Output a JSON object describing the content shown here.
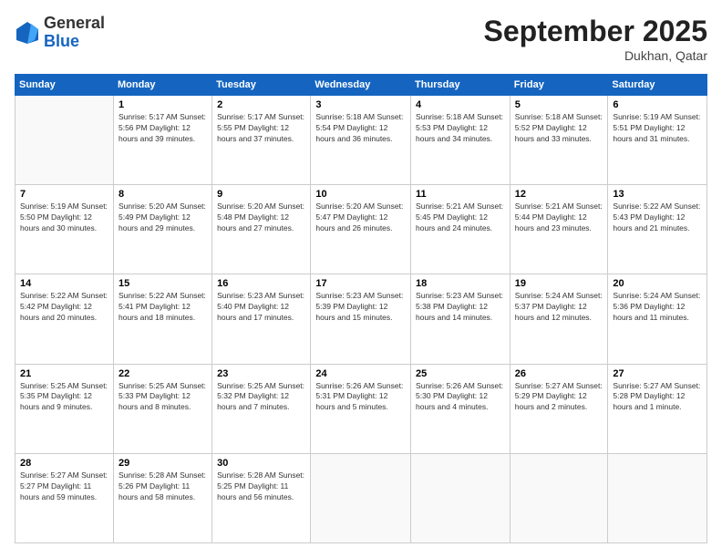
{
  "header": {
    "logo_general": "General",
    "logo_blue": "Blue",
    "month_title": "September 2025",
    "location": "Dukhan, Qatar"
  },
  "days_of_week": [
    "Sunday",
    "Monday",
    "Tuesday",
    "Wednesday",
    "Thursday",
    "Friday",
    "Saturday"
  ],
  "weeks": [
    [
      {
        "day": "",
        "info": ""
      },
      {
        "day": "1",
        "info": "Sunrise: 5:17 AM\nSunset: 5:56 PM\nDaylight: 12 hours\nand 39 minutes."
      },
      {
        "day": "2",
        "info": "Sunrise: 5:17 AM\nSunset: 5:55 PM\nDaylight: 12 hours\nand 37 minutes."
      },
      {
        "day": "3",
        "info": "Sunrise: 5:18 AM\nSunset: 5:54 PM\nDaylight: 12 hours\nand 36 minutes."
      },
      {
        "day": "4",
        "info": "Sunrise: 5:18 AM\nSunset: 5:53 PM\nDaylight: 12 hours\nand 34 minutes."
      },
      {
        "day": "5",
        "info": "Sunrise: 5:18 AM\nSunset: 5:52 PM\nDaylight: 12 hours\nand 33 minutes."
      },
      {
        "day": "6",
        "info": "Sunrise: 5:19 AM\nSunset: 5:51 PM\nDaylight: 12 hours\nand 31 minutes."
      }
    ],
    [
      {
        "day": "7",
        "info": "Sunrise: 5:19 AM\nSunset: 5:50 PM\nDaylight: 12 hours\nand 30 minutes."
      },
      {
        "day": "8",
        "info": "Sunrise: 5:20 AM\nSunset: 5:49 PM\nDaylight: 12 hours\nand 29 minutes."
      },
      {
        "day": "9",
        "info": "Sunrise: 5:20 AM\nSunset: 5:48 PM\nDaylight: 12 hours\nand 27 minutes."
      },
      {
        "day": "10",
        "info": "Sunrise: 5:20 AM\nSunset: 5:47 PM\nDaylight: 12 hours\nand 26 minutes."
      },
      {
        "day": "11",
        "info": "Sunrise: 5:21 AM\nSunset: 5:45 PM\nDaylight: 12 hours\nand 24 minutes."
      },
      {
        "day": "12",
        "info": "Sunrise: 5:21 AM\nSunset: 5:44 PM\nDaylight: 12 hours\nand 23 minutes."
      },
      {
        "day": "13",
        "info": "Sunrise: 5:22 AM\nSunset: 5:43 PM\nDaylight: 12 hours\nand 21 minutes."
      }
    ],
    [
      {
        "day": "14",
        "info": "Sunrise: 5:22 AM\nSunset: 5:42 PM\nDaylight: 12 hours\nand 20 minutes."
      },
      {
        "day": "15",
        "info": "Sunrise: 5:22 AM\nSunset: 5:41 PM\nDaylight: 12 hours\nand 18 minutes."
      },
      {
        "day": "16",
        "info": "Sunrise: 5:23 AM\nSunset: 5:40 PM\nDaylight: 12 hours\nand 17 minutes."
      },
      {
        "day": "17",
        "info": "Sunrise: 5:23 AM\nSunset: 5:39 PM\nDaylight: 12 hours\nand 15 minutes."
      },
      {
        "day": "18",
        "info": "Sunrise: 5:23 AM\nSunset: 5:38 PM\nDaylight: 12 hours\nand 14 minutes."
      },
      {
        "day": "19",
        "info": "Sunrise: 5:24 AM\nSunset: 5:37 PM\nDaylight: 12 hours\nand 12 minutes."
      },
      {
        "day": "20",
        "info": "Sunrise: 5:24 AM\nSunset: 5:36 PM\nDaylight: 12 hours\nand 11 minutes."
      }
    ],
    [
      {
        "day": "21",
        "info": "Sunrise: 5:25 AM\nSunset: 5:35 PM\nDaylight: 12 hours\nand 9 minutes."
      },
      {
        "day": "22",
        "info": "Sunrise: 5:25 AM\nSunset: 5:33 PM\nDaylight: 12 hours\nand 8 minutes."
      },
      {
        "day": "23",
        "info": "Sunrise: 5:25 AM\nSunset: 5:32 PM\nDaylight: 12 hours\nand 7 minutes."
      },
      {
        "day": "24",
        "info": "Sunrise: 5:26 AM\nSunset: 5:31 PM\nDaylight: 12 hours\nand 5 minutes."
      },
      {
        "day": "25",
        "info": "Sunrise: 5:26 AM\nSunset: 5:30 PM\nDaylight: 12 hours\nand 4 minutes."
      },
      {
        "day": "26",
        "info": "Sunrise: 5:27 AM\nSunset: 5:29 PM\nDaylight: 12 hours\nand 2 minutes."
      },
      {
        "day": "27",
        "info": "Sunrise: 5:27 AM\nSunset: 5:28 PM\nDaylight: 12 hours\nand 1 minute."
      }
    ],
    [
      {
        "day": "28",
        "info": "Sunrise: 5:27 AM\nSunset: 5:27 PM\nDaylight: 11 hours\nand 59 minutes."
      },
      {
        "day": "29",
        "info": "Sunrise: 5:28 AM\nSunset: 5:26 PM\nDaylight: 11 hours\nand 58 minutes."
      },
      {
        "day": "30",
        "info": "Sunrise: 5:28 AM\nSunset: 5:25 PM\nDaylight: 11 hours\nand 56 minutes."
      },
      {
        "day": "",
        "info": ""
      },
      {
        "day": "",
        "info": ""
      },
      {
        "day": "",
        "info": ""
      },
      {
        "day": "",
        "info": ""
      }
    ]
  ]
}
